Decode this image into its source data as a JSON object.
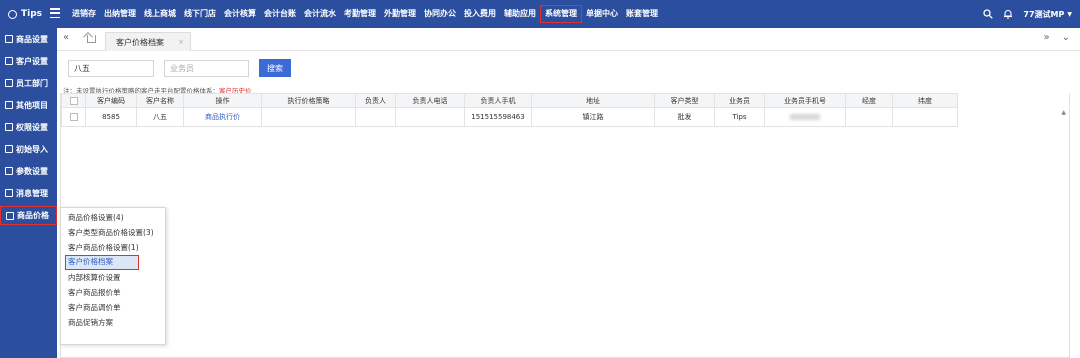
{
  "brand": {
    "name": "Tips"
  },
  "nav": [
    {
      "label": "进销存"
    },
    {
      "label": "出纳管理"
    },
    {
      "label": "线上商城"
    },
    {
      "label": "线下门店"
    },
    {
      "label": "会计核算"
    },
    {
      "label": "会计台账"
    },
    {
      "label": "会计流水"
    },
    {
      "label": "考勤管理"
    },
    {
      "label": "外勤管理"
    },
    {
      "label": "协同办公"
    },
    {
      "label": "投入费用"
    },
    {
      "label": "辅助应用"
    },
    {
      "label": "系统管理",
      "active": true
    },
    {
      "label": "单据中心"
    },
    {
      "label": "账套管理"
    }
  ],
  "user": {
    "name": "77测试MP"
  },
  "sidebar": [
    {
      "label": "商品设置"
    },
    {
      "label": "客户设置"
    },
    {
      "label": "员工部门"
    },
    {
      "label": "其他项目"
    },
    {
      "label": "权限设置"
    },
    {
      "label": "初始导入"
    },
    {
      "label": "参数设置"
    },
    {
      "label": "消息管理"
    },
    {
      "label": "商品价格",
      "active": true
    }
  ],
  "tab": {
    "label": "客户价格档案",
    "close": "×"
  },
  "search": {
    "customer_value": "八五",
    "salesman_placeholder": "业务员",
    "button": "搜索"
  },
  "note": {
    "text": "注：未设置执行价格策略的客户走平台配置价格体系：",
    "highlight": "客户历史价"
  },
  "table": {
    "headers": [
      "客户编码",
      "客户名称",
      "操作",
      "执行价格策略",
      "负责人",
      "负责人电话",
      "负责人手机",
      "地址",
      "客户类型",
      "业务员",
      "业务员手机号",
      "经度",
      "纬度"
    ],
    "rows": [
      {
        "code": "8585",
        "name": "八五",
        "action": "商品执行价",
        "strategy": "",
        "owner": "",
        "owner_phone": "",
        "owner_mobile": "151515598463",
        "address": "镇江路",
        "type": "批发",
        "salesman": "Tips",
        "salesman_mobile": "",
        "lng": "",
        "lat": ""
      }
    ]
  },
  "popup": [
    {
      "label": "商品价格设置(4)"
    },
    {
      "label": "客户类型商品价格设置(3)"
    },
    {
      "label": "客户商品价格设置(1)"
    },
    {
      "label": "客户价格档案",
      "active": true
    },
    {
      "label": "内部核算价设置"
    },
    {
      "label": "客户商品报价单"
    },
    {
      "label": "客户商品调价单"
    },
    {
      "label": "商品促销方案"
    }
  ]
}
